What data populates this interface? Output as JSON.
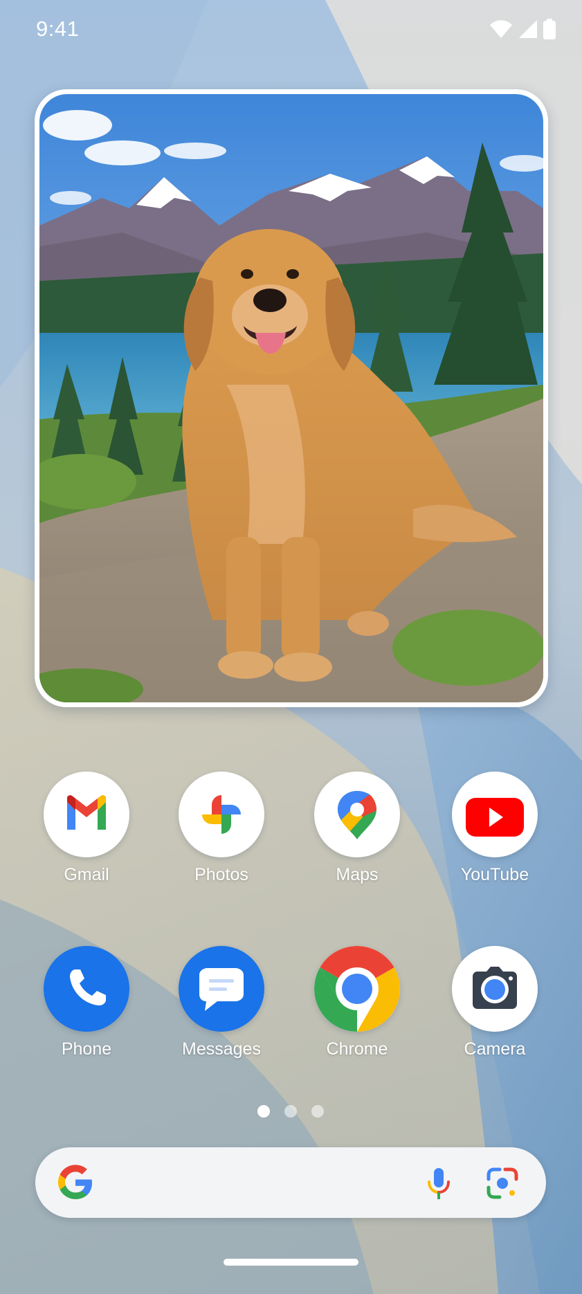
{
  "status_bar": {
    "time": "9:41",
    "icons": [
      "wifi-icon",
      "cell-signal-icon",
      "battery-icon"
    ]
  },
  "photo_widget": {
    "subject": "golden retriever sitting on a rock in front of a mountain lake"
  },
  "apps": [
    {
      "id": "gmail",
      "label": "Gmail",
      "icon": "gmail-icon"
    },
    {
      "id": "photos",
      "label": "Photos",
      "icon": "photos-pinwheel-icon"
    },
    {
      "id": "maps",
      "label": "Maps",
      "icon": "maps-pin-icon"
    },
    {
      "id": "youtube",
      "label": "YouTube",
      "icon": "youtube-play-icon"
    },
    {
      "id": "phone",
      "label": "Phone",
      "icon": "phone-handset-icon"
    },
    {
      "id": "messages",
      "label": "Messages",
      "icon": "messages-bubble-icon"
    },
    {
      "id": "chrome",
      "label": "Chrome",
      "icon": "chrome-icon"
    },
    {
      "id": "camera",
      "label": "Camera",
      "icon": "camera-icon"
    }
  ],
  "page_indicator": {
    "count": 3,
    "active_index": 0
  },
  "search_bar": {
    "icons": [
      "google-g-icon",
      "microphone-icon",
      "google-lens-icon"
    ]
  },
  "colors": {
    "google_blue": "#4285f4",
    "google_red": "#ea4335",
    "google_yellow": "#fbbc04",
    "google_green": "#34a853",
    "youtube_red": "#ff0000",
    "phone_blue": "#1a73e8"
  }
}
